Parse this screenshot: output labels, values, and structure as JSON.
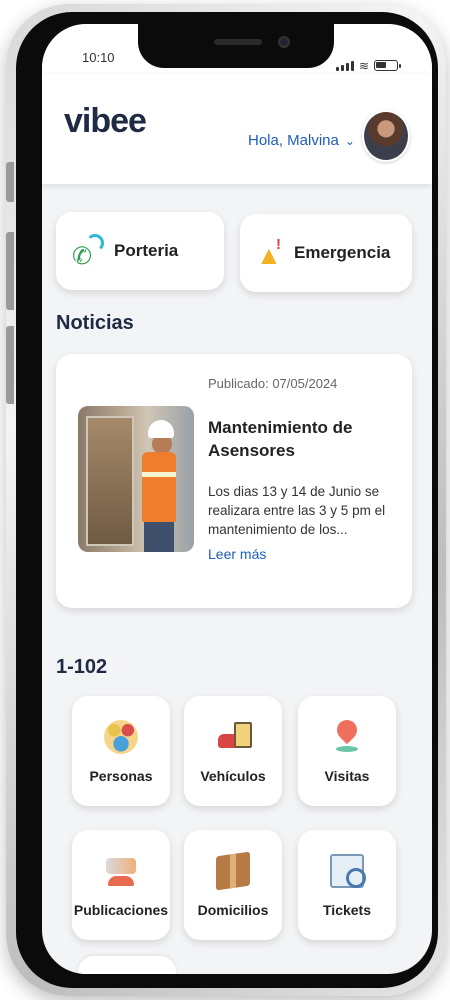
{
  "status_bar": {
    "time": "10:10"
  },
  "header": {
    "logo_text": "vibee",
    "greeting": "Hola, Malvina",
    "greeting_icon": "chevron-down-icon",
    "avatar_icon": "user-avatar"
  },
  "quick_actions": [
    {
      "label": "Porteria",
      "icon": "phone-call-icon",
      "color": "#2e9e4d"
    },
    {
      "label": "Emergencia",
      "icon": "alarm-bell-icon",
      "color": "#f2b322"
    }
  ],
  "news": {
    "section_title": "Noticias",
    "date": "Publicado: 07/05/2024",
    "title": "Mantenimiento de Asensores",
    "body": "Los dias 13 y 14 de Junio se realizara entre las 3 y 5 pm el mantenimiento de los...",
    "link": "Leer más",
    "image_icon": "elevator-worker-image"
  },
  "unit": {
    "title": "1-102",
    "tiles": [
      {
        "label": "Personas",
        "icon": "people-icon"
      },
      {
        "label": "Vehículos",
        "icon": "vehicle-icon"
      },
      {
        "label": "Visitas",
        "icon": "location-pin-icon"
      },
      {
        "label": "Publicaciones",
        "icon": "publications-icon"
      },
      {
        "label": "Domicilios",
        "icon": "package-icon"
      },
      {
        "label": "Tickets",
        "icon": "ticket-icon"
      }
    ]
  },
  "colors": {
    "accent_blue": "#1d5fb8",
    "brand_dark": "#1f2a44",
    "brand_red": "#e23b3b",
    "background": "#f3f4f6"
  }
}
